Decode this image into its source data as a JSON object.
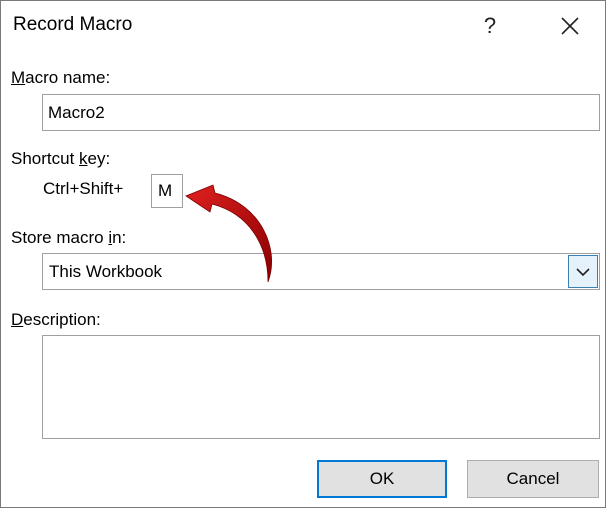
{
  "window": {
    "title": "Record Macro",
    "help_label": "?",
    "close_label": "✕"
  },
  "macro_name": {
    "label_accel": "M",
    "label_rest": "acro name:",
    "value": "Macro2"
  },
  "shortcut": {
    "label_pre": "Shortcut ",
    "label_accel": "k",
    "label_rest": "ey:",
    "prefix": "Ctrl+Shift+",
    "value": "M"
  },
  "store": {
    "label_pre": "Store macro ",
    "label_accel": "i",
    "label_rest": "n:",
    "selected": "This Workbook"
  },
  "description": {
    "label_accel": "D",
    "label_rest": "escription:",
    "value": ""
  },
  "buttons": {
    "ok": "OK",
    "cancel": "Cancel"
  },
  "colors": {
    "annotation_arrow": "#c00000",
    "focus_border": "#0078d7"
  }
}
